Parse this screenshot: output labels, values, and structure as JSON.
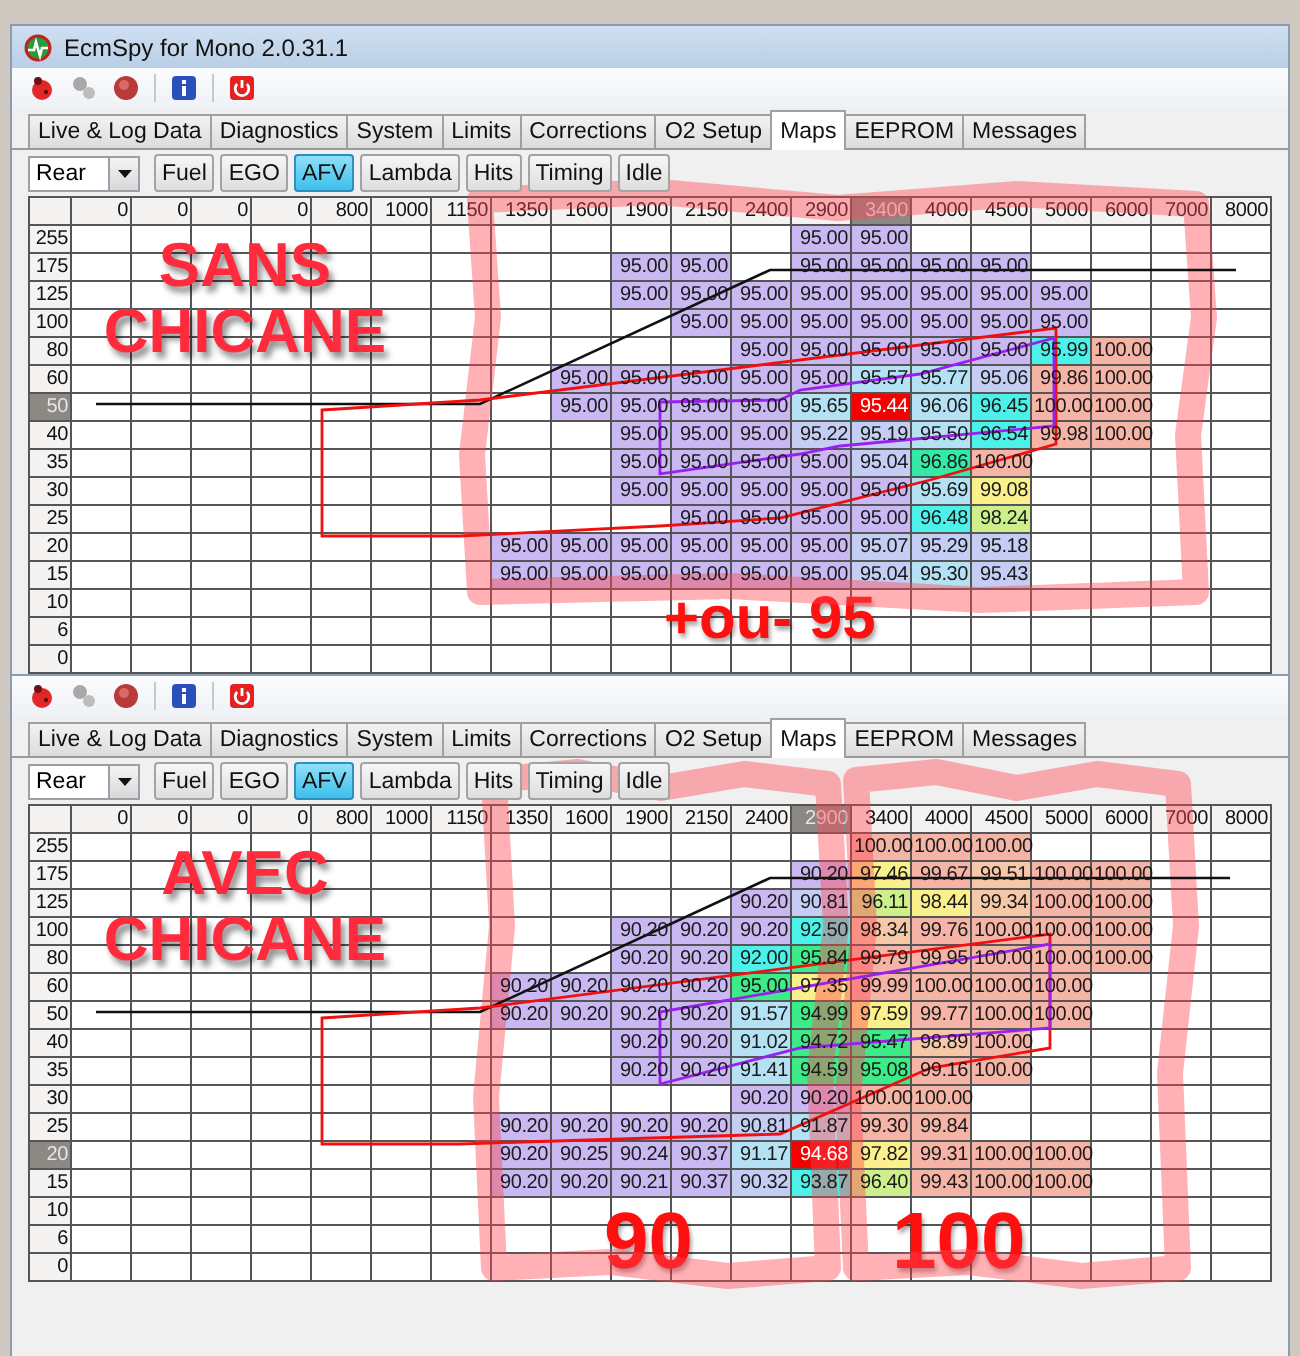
{
  "windows": [
    {
      "title": "EcmSpy for Mono 2.0.31.1",
      "tabs": [
        {
          "label": "Live & Log Data",
          "selected": false
        },
        {
          "label": "Diagnostics",
          "selected": false
        },
        {
          "label": "System",
          "selected": false
        },
        {
          "label": "Limits",
          "selected": false
        },
        {
          "label": "Corrections",
          "selected": false
        },
        {
          "label": "O2 Setup",
          "selected": false
        },
        {
          "label": "Maps",
          "selected": true
        },
        {
          "label": "EEPROM",
          "selected": false
        },
        {
          "label": "Messages",
          "selected": false
        }
      ],
      "map_selector": {
        "value": "Rear"
      },
      "map_buttons": [
        {
          "label": "Fuel",
          "selected": false
        },
        {
          "label": "EGO",
          "selected": false
        },
        {
          "label": "AFV",
          "selected": true
        },
        {
          "label": "Lambda",
          "selected": false
        },
        {
          "label": "Hits",
          "selected": false
        },
        {
          "label": "Timing",
          "selected": false
        },
        {
          "label": "Idle",
          "selected": false
        }
      ],
      "grid": {
        "columns": [
          {
            "label": "0",
            "selected": false
          },
          {
            "label": "0",
            "selected": false
          },
          {
            "label": "0",
            "selected": false
          },
          {
            "label": "0",
            "selected": false
          },
          {
            "label": "800",
            "selected": false
          },
          {
            "label": "1000",
            "selected": false
          },
          {
            "label": "1150",
            "selected": false
          },
          {
            "label": "1350",
            "selected": false
          },
          {
            "label": "1600",
            "selected": false
          },
          {
            "label": "1900",
            "selected": false
          },
          {
            "label": "2150",
            "selected": false
          },
          {
            "label": "2400",
            "selected": false
          },
          {
            "label": "2900",
            "selected": false
          },
          {
            "label": "3400",
            "selected": true
          },
          {
            "label": "4000",
            "selected": false
          },
          {
            "label": "4500",
            "selected": false
          },
          {
            "label": "5000",
            "selected": false
          },
          {
            "label": "6000",
            "selected": false
          },
          {
            "label": "7000",
            "selected": false
          },
          {
            "label": "8000",
            "selected": false
          }
        ],
        "rows": [
          {
            "label": "255",
            "selected": false,
            "cells": [
              null,
              null,
              null,
              null,
              null,
              null,
              null,
              null,
              null,
              null,
              null,
              null,
              {
                "value": "95.00",
                "color": "#c9b8f2"
              },
              {
                "value": "95.00",
                "color": "#c9b8f2"
              }
            ]
          },
          {
            "label": "175",
            "selected": false,
            "cells": [
              null,
              null,
              null,
              null,
              null,
              null,
              null,
              null,
              null,
              {
                "value": "95.00",
                "color": "#c9b8f2"
              },
              {
                "value": "95.00",
                "color": "#c9b8f2"
              },
              null,
              {
                "value": "95.00",
                "color": "#c9b8f2"
              },
              {
                "value": "95.00",
                "color": "#c9b8f2"
              },
              {
                "value": "95.00",
                "color": "#c9b8f2"
              },
              {
                "value": "95.00",
                "color": "#c9b8f2"
              }
            ]
          },
          {
            "label": "125",
            "selected": false,
            "cells": [
              null,
              null,
              null,
              null,
              null,
              null,
              null,
              null,
              null,
              {
                "value": "95.00",
                "color": "#c9b8f2"
              },
              {
                "value": "95.00",
                "color": "#c9b8f2"
              },
              {
                "value": "95.00",
                "color": "#c9b8f2"
              },
              {
                "value": "95.00",
                "color": "#c9b8f2"
              },
              {
                "value": "95.00",
                "color": "#c9b8f2"
              },
              {
                "value": "95.00",
                "color": "#c9b8f2"
              },
              {
                "value": "95.00",
                "color": "#c9b8f2"
              },
              {
                "value": "95.00",
                "color": "#c9b8f2"
              }
            ]
          },
          {
            "label": "100",
            "selected": false,
            "cells": [
              null,
              null,
              null,
              null,
              null,
              null,
              null,
              null,
              null,
              null,
              {
                "value": "95.00",
                "color": "#c9b8f2"
              },
              {
                "value": "95.00",
                "color": "#c9b8f2"
              },
              {
                "value": "95.00",
                "color": "#c9b8f2"
              },
              {
                "value": "95.00",
                "color": "#c9b8f2"
              },
              {
                "value": "95.00",
                "color": "#c9b8f2"
              },
              {
                "value": "95.00",
                "color": "#c9b8f2"
              },
              {
                "value": "95.00",
                "color": "#c9b8f2"
              }
            ]
          },
          {
            "label": "80",
            "selected": false,
            "cells": [
              null,
              null,
              null,
              null,
              null,
              null,
              null,
              null,
              null,
              null,
              null,
              {
                "value": "95.00",
                "color": "#c9b8f2"
              },
              {
                "value": "95.00",
                "color": "#c9b8f2"
              },
              {
                "value": "95.00",
                "color": "#c9b8f2"
              },
              {
                "value": "95.00",
                "color": "#c9b8f2"
              },
              {
                "value": "95.00",
                "color": "#c9b8f2"
              },
              {
                "value": "95.99",
                "color": "#4cf2ea"
              },
              {
                "value": "100.00",
                "color": "#f6b4a6"
              }
            ]
          },
          {
            "label": "60",
            "selected": false,
            "cells": [
              null,
              null,
              null,
              null,
              null,
              null,
              null,
              null,
              {
                "value": "95.00",
                "color": "#c9b8f2"
              },
              {
                "value": "95.00",
                "color": "#c9b8f2"
              },
              {
                "value": "95.00",
                "color": "#c9b8f2"
              },
              {
                "value": "95.00",
                "color": "#c9b8f2"
              },
              {
                "value": "95.00",
                "color": "#c9b8f2"
              },
              {
                "value": "95.57",
                "color": "#b4e2f4"
              },
              {
                "value": "95.77",
                "color": "#b4e2f4"
              },
              {
                "value": "95.06",
                "color": "#c4cef4"
              },
              {
                "value": "99.86",
                "color": "#f6b4a6"
              },
              {
                "value": "100.00",
                "color": "#f6b4a6"
              }
            ]
          },
          {
            "label": "50",
            "selected": true,
            "cells": [
              null,
              null,
              null,
              null,
              null,
              null,
              null,
              null,
              {
                "value": "95.00",
                "color": "#c9b8f2"
              },
              {
                "value": "95.00",
                "color": "#c9b8f2"
              },
              {
                "value": "95.00",
                "color": "#c9b8f2"
              },
              {
                "value": "95.00",
                "color": "#c9b8f2"
              },
              {
                "value": "95.65",
                "color": "#b4e2f4"
              },
              {
                "value": "95.44",
                "color": "#f40000"
              },
              {
                "value": "96.06",
                "color": "#b4e2f4"
              },
              {
                "value": "96.45",
                "color": "#4cf2ea"
              },
              {
                "value": "100.00",
                "color": "#f6b4a6"
              },
              {
                "value": "100.00",
                "color": "#f6b4a6"
              }
            ]
          },
          {
            "label": "40",
            "selected": false,
            "cells": [
              null,
              null,
              null,
              null,
              null,
              null,
              null,
              null,
              null,
              {
                "value": "95.00",
                "color": "#c9b8f2"
              },
              {
                "value": "95.00",
                "color": "#c9b8f2"
              },
              {
                "value": "95.00",
                "color": "#c9b8f2"
              },
              {
                "value": "95.22",
                "color": "#c4cef4"
              },
              {
                "value": "95.19",
                "color": "#c4cef4"
              },
              {
                "value": "95.50",
                "color": "#b4e2f4"
              },
              {
                "value": "96.54",
                "color": "#4cf2ea"
              },
              {
                "value": "99.98",
                "color": "#f6b4a6"
              },
              {
                "value": "100.00",
                "color": "#f6b4a6"
              }
            ]
          },
          {
            "label": "35",
            "selected": false,
            "cells": [
              null,
              null,
              null,
              null,
              null,
              null,
              null,
              null,
              null,
              {
                "value": "95.00",
                "color": "#c9b8f2"
              },
              {
                "value": "95.00",
                "color": "#c9b8f2"
              },
              {
                "value": "95.00",
                "color": "#c9b8f2"
              },
              {
                "value": "95.00",
                "color": "#c9b8f2"
              },
              {
                "value": "95.04",
                "color": "#c4cef4"
              },
              {
                "value": "96.86",
                "color": "#34eaa8"
              },
              {
                "value": "100.00",
                "color": "#f6b4a6"
              }
            ]
          },
          {
            "label": "30",
            "selected": false,
            "cells": [
              null,
              null,
              null,
              null,
              null,
              null,
              null,
              null,
              null,
              {
                "value": "95.00",
                "color": "#c9b8f2"
              },
              {
                "value": "95.00",
                "color": "#c9b8f2"
              },
              {
                "value": "95.00",
                "color": "#c9b8f2"
              },
              {
                "value": "95.00",
                "color": "#c9b8f2"
              },
              {
                "value": "95.00",
                "color": "#c9b8f2"
              },
              {
                "value": "95.69",
                "color": "#b4e2f4"
              },
              {
                "value": "99.08",
                "color": "#faf08c"
              }
            ]
          },
          {
            "label": "25",
            "selected": false,
            "cells": [
              null,
              null,
              null,
              null,
              null,
              null,
              null,
              null,
              null,
              null,
              {
                "value": "95.00",
                "color": "#c9b8f2"
              },
              {
                "value": "95.00",
                "color": "#c9b8f2"
              },
              {
                "value": "95.00",
                "color": "#c9b8f2"
              },
              {
                "value": "95.00",
                "color": "#c9b8f2"
              },
              {
                "value": "96.48",
                "color": "#4cf2ea"
              },
              {
                "value": "98.24",
                "color": "#cdf08c"
              }
            ]
          },
          {
            "label": "20",
            "selected": false,
            "cells": [
              null,
              null,
              null,
              null,
              null,
              null,
              null,
              {
                "value": "95.00",
                "color": "#c9b8f2"
              },
              {
                "value": "95.00",
                "color": "#c9b8f2"
              },
              {
                "value": "95.00",
                "color": "#c9b8f2"
              },
              {
                "value": "95.00",
                "color": "#c9b8f2"
              },
              {
                "value": "95.00",
                "color": "#c9b8f2"
              },
              {
                "value": "95.00",
                "color": "#c9b8f2"
              },
              {
                "value": "95.07",
                "color": "#c4cef4"
              },
              {
                "value": "95.29",
                "color": "#c4cef4"
              },
              {
                "value": "95.18",
                "color": "#c4cef4"
              }
            ]
          },
          {
            "label": "15",
            "selected": false,
            "cells": [
              null,
              null,
              null,
              null,
              null,
              null,
              null,
              {
                "value": "95.00",
                "color": "#c9b8f2"
              },
              {
                "value": "95.00",
                "color": "#c9b8f2"
              },
              {
                "value": "95.00",
                "color": "#c9b8f2"
              },
              {
                "value": "95.00",
                "color": "#c9b8f2"
              },
              {
                "value": "95.00",
                "color": "#c9b8f2"
              },
              {
                "value": "95.00",
                "color": "#c9b8f2"
              },
              {
                "value": "95.04",
                "color": "#c4cef4"
              },
              {
                "value": "95.30",
                "color": "#b4e2f4"
              },
              {
                "value": "95.43",
                "color": "#c4cef4"
              }
            ]
          },
          {
            "label": "10",
            "selected": false
          },
          {
            "label": "6",
            "selected": false
          },
          {
            "label": "0",
            "selected": false
          }
        ]
      },
      "annotations": [
        {
          "kind": "title",
          "text": "SANS CHICANE"
        },
        {
          "kind": "note",
          "text": "+ou- 95"
        }
      ]
    },
    {
      "tabs": [
        {
          "label": "Live & Log Data",
          "selected": false
        },
        {
          "label": "Diagnostics",
          "selected": false
        },
        {
          "label": "System",
          "selected": false
        },
        {
          "label": "Limits",
          "selected": false
        },
        {
          "label": "Corrections",
          "selected": false
        },
        {
          "label": "O2 Setup",
          "selected": false
        },
        {
          "label": "Maps",
          "selected": true
        },
        {
          "label": "EEPROM",
          "selected": false
        },
        {
          "label": "Messages",
          "selected": false
        }
      ],
      "map_selector": {
        "value": "Rear"
      },
      "map_buttons": [
        {
          "label": "Fuel",
          "selected": false
        },
        {
          "label": "EGO",
          "selected": false
        },
        {
          "label": "AFV",
          "selected": true
        },
        {
          "label": "Lambda",
          "selected": false
        },
        {
          "label": "Hits",
          "selected": false
        },
        {
          "label": "Timing",
          "selected": false
        },
        {
          "label": "Idle",
          "selected": false
        }
      ],
      "grid": {
        "columns": [
          {
            "label": "0",
            "selected": false
          },
          {
            "label": "0",
            "selected": false
          },
          {
            "label": "0",
            "selected": false
          },
          {
            "label": "0",
            "selected": false
          },
          {
            "label": "800",
            "selected": false
          },
          {
            "label": "1000",
            "selected": false
          },
          {
            "label": "1150",
            "selected": false
          },
          {
            "label": "1350",
            "selected": false
          },
          {
            "label": "1600",
            "selected": false
          },
          {
            "label": "1900",
            "selected": false
          },
          {
            "label": "2150",
            "selected": false
          },
          {
            "label": "2400",
            "selected": false
          },
          {
            "label": "2900",
            "selected": true
          },
          {
            "label": "3400",
            "selected": false
          },
          {
            "label": "4000",
            "selected": false
          },
          {
            "label": "4500",
            "selected": false
          },
          {
            "label": "5000",
            "selected": false
          },
          {
            "label": "6000",
            "selected": false
          },
          {
            "label": "7000",
            "selected": false
          },
          {
            "label": "8000",
            "selected": false
          }
        ],
        "rows": [
          {
            "label": "255",
            "selected": false,
            "cells": [
              null,
              null,
              null,
              null,
              null,
              null,
              null,
              null,
              null,
              null,
              null,
              null,
              null,
              {
                "value": "100.00",
                "color": "#f6b4a6"
              },
              {
                "value": "100.00",
                "color": "#f6b4a6"
              },
              {
                "value": "100.00",
                "color": "#f6b4a6"
              }
            ]
          },
          {
            "label": "175",
            "selected": false,
            "cells": [
              null,
              null,
              null,
              null,
              null,
              null,
              null,
              null,
              null,
              null,
              null,
              null,
              {
                "value": "90.20",
                "color": "#c9b8f2"
              },
              {
                "value": "97.46",
                "color": "#faf08c"
              },
              {
                "value": "99.67",
                "color": "#f6b4a6"
              },
              {
                "value": "99.51",
                "color": "#f6c8a8"
              },
              {
                "value": "100.00",
                "color": "#f6b4a6"
              },
              {
                "value": "100.00",
                "color": "#f6b4a6"
              }
            ]
          },
          {
            "label": "125",
            "selected": false,
            "cells": [
              null,
              null,
              null,
              null,
              null,
              null,
              null,
              null,
              null,
              null,
              null,
              {
                "value": "90.20",
                "color": "#c9b8f2"
              },
              {
                "value": "90.81",
                "color": "#c4cef4"
              },
              {
                "value": "96.11",
                "color": "#cdf08c"
              },
              {
                "value": "98.44",
                "color": "#faf08c"
              },
              {
                "value": "99.34",
                "color": "#f6c8a8"
              },
              {
                "value": "100.00",
                "color": "#f6b4a6"
              },
              {
                "value": "100.00",
                "color": "#f6b4a6"
              }
            ]
          },
          {
            "label": "100",
            "selected": false,
            "cells": [
              null,
              null,
              null,
              null,
              null,
              null,
              null,
              null,
              null,
              {
                "value": "90.20",
                "color": "#c9b8f2"
              },
              {
                "value": "90.20",
                "color": "#c9b8f2"
              },
              {
                "value": "90.20",
                "color": "#c9b8f2"
              },
              {
                "value": "92.50",
                "color": "#4cf2ea"
              },
              {
                "value": "98.34",
                "color": "#f6c8a8"
              },
              {
                "value": "99.76",
                "color": "#f6b4a6"
              },
              {
                "value": "100.00",
                "color": "#f6b4a6"
              },
              {
                "value": "100.00",
                "color": "#f6b4a6"
              },
              {
                "value": "100.00",
                "color": "#f6b4a6"
              }
            ]
          },
          {
            "label": "80",
            "selected": false,
            "cells": [
              null,
              null,
              null,
              null,
              null,
              null,
              null,
              null,
              null,
              {
                "value": "90.20",
                "color": "#c9b8f2"
              },
              {
                "value": "90.20",
                "color": "#c9b8f2"
              },
              {
                "value": "92.00",
                "color": "#4cf2ea"
              },
              {
                "value": "95.84",
                "color": "#3cec88"
              },
              {
                "value": "99.79",
                "color": "#f6b4a6"
              },
              {
                "value": "99.95",
                "color": "#f6b4a6"
              },
              {
                "value": "100.00",
                "color": "#f6b4a6"
              },
              {
                "value": "100.00",
                "color": "#f6b4a6"
              },
              {
                "value": "100.00",
                "color": "#f6b4a6"
              }
            ]
          },
          {
            "label": "60",
            "selected": false,
            "cells": [
              null,
              null,
              null,
              null,
              null,
              null,
              null,
              {
                "value": "90.20",
                "color": "#c9b8f2"
              },
              {
                "value": "90.20",
                "color": "#c9b8f2"
              },
              {
                "value": "90.20",
                "color": "#c9b8f2"
              },
              {
                "value": "90.20",
                "color": "#c9b8f2"
              },
              {
                "value": "95.00",
                "color": "#3cec88"
              },
              {
                "value": "97.35",
                "color": "#faf08c"
              },
              {
                "value": "99.99",
                "color": "#f6b4a6"
              },
              {
                "value": "100.00",
                "color": "#f6b4a6"
              },
              {
                "value": "100.00",
                "color": "#f6b4a6"
              },
              {
                "value": "100.00",
                "color": "#f6b4a6"
              }
            ]
          },
          {
            "label": "50",
            "selected": false,
            "cells": [
              null,
              null,
              null,
              null,
              null,
              null,
              null,
              {
                "value": "90.20",
                "color": "#c9b8f2"
              },
              {
                "value": "90.20",
                "color": "#c9b8f2"
              },
              {
                "value": "90.20",
                "color": "#c9b8f2"
              },
              {
                "value": "90.20",
                "color": "#c9b8f2"
              },
              {
                "value": "91.57",
                "color": "#b4e2f4"
              },
              {
                "value": "94.99",
                "color": "#3cec88"
              },
              {
                "value": "97.59",
                "color": "#faf08c"
              },
              {
                "value": "99.77",
                "color": "#f6b4a6"
              },
              {
                "value": "100.00",
                "color": "#f6b4a6"
              },
              {
                "value": "100.00",
                "color": "#f6b4a6"
              }
            ]
          },
          {
            "label": "40",
            "selected": false,
            "cells": [
              null,
              null,
              null,
              null,
              null,
              null,
              null,
              null,
              null,
              {
                "value": "90.20",
                "color": "#c9b8f2"
              },
              {
                "value": "90.20",
                "color": "#c9b8f2"
              },
              {
                "value": "91.02",
                "color": "#b4e2f4"
              },
              {
                "value": "94.72",
                "color": "#3cec88"
              },
              {
                "value": "95.47",
                "color": "#3cec88"
              },
              {
                "value": "98.89",
                "color": "#f6c8a8"
              },
              {
                "value": "100.00",
                "color": "#f6b4a6"
              }
            ]
          },
          {
            "label": "35",
            "selected": false,
            "cells": [
              null,
              null,
              null,
              null,
              null,
              null,
              null,
              null,
              null,
              {
                "value": "90.20",
                "color": "#c9b8f2"
              },
              {
                "value": "90.20",
                "color": "#c9b8f2"
              },
              {
                "value": "91.41",
                "color": "#b4e2f4"
              },
              {
                "value": "94.59",
                "color": "#3cec88"
              },
              {
                "value": "95.08",
                "color": "#3cec88"
              },
              {
                "value": "99.16",
                "color": "#f6b4a6"
              },
              {
                "value": "100.00",
                "color": "#f6b4a6"
              }
            ]
          },
          {
            "label": "30",
            "selected": false,
            "cells": [
              null,
              null,
              null,
              null,
              null,
              null,
              null,
              null,
              null,
              null,
              null,
              {
                "value": "90.20",
                "color": "#c9b8f2"
              },
              {
                "value": "90.20",
                "color": "#c9b8f2"
              },
              {
                "value": "100.00",
                "color": "#f6b4a6"
              },
              {
                "value": "100.00",
                "color": "#f6b4a6"
              }
            ]
          },
          {
            "label": "25",
            "selected": false,
            "cells": [
              null,
              null,
              null,
              null,
              null,
              null,
              null,
              {
                "value": "90.20",
                "color": "#c9b8f2"
              },
              {
                "value": "90.20",
                "color": "#c9b8f2"
              },
              {
                "value": "90.20",
                "color": "#c9b8f2"
              },
              {
                "value": "90.20",
                "color": "#c9b8f2"
              },
              {
                "value": "90.81",
                "color": "#c4cef4"
              },
              {
                "value": "91.87",
                "color": "#b4e2f4"
              },
              {
                "value": "99.30",
                "color": "#f6b4a6"
              },
              {
                "value": "99.84",
                "color": "#f6b4a6"
              }
            ]
          },
          {
            "label": "20",
            "selected": true,
            "cells": [
              null,
              null,
              null,
              null,
              null,
              null,
              null,
              {
                "value": "90.20",
                "color": "#c9b8f2"
              },
              {
                "value": "90.25",
                "color": "#c9b8f2"
              },
              {
                "value": "90.24",
                "color": "#c9b8f2"
              },
              {
                "value": "90.37",
                "color": "#c9b8f2"
              },
              {
                "value": "91.17",
                "color": "#b4e2f4"
              },
              {
                "value": "94.68",
                "color": "#f40000"
              },
              {
                "value": "97.82",
                "color": "#faf08c"
              },
              {
                "value": "99.31",
                "color": "#f6b4a6"
              },
              {
                "value": "100.00",
                "color": "#f6b4a6"
              },
              {
                "value": "100.00",
                "color": "#f6b4a6"
              }
            ]
          },
          {
            "label": "15",
            "selected": false,
            "cells": [
              null,
              null,
              null,
              null,
              null,
              null,
              null,
              {
                "value": "90.20",
                "color": "#c9b8f2"
              },
              {
                "value": "90.20",
                "color": "#c9b8f2"
              },
              {
                "value": "90.21",
                "color": "#c9b8f2"
              },
              {
                "value": "90.37",
                "color": "#c9b8f2"
              },
              {
                "value": "90.32",
                "color": "#c4cef4"
              },
              {
                "value": "93.87",
                "color": "#4cf2ea"
              },
              {
                "value": "96.40",
                "color": "#cdf08c"
              },
              {
                "value": "99.43",
                "color": "#f6b4a6"
              },
              {
                "value": "100.00",
                "color": "#f6b4a6"
              },
              {
                "value": "100.00",
                "color": "#f6b4a6"
              }
            ]
          },
          {
            "label": "10",
            "selected": false
          },
          {
            "label": "6",
            "selected": false
          },
          {
            "label": "0",
            "selected": false
          }
        ]
      },
      "annotations": [
        {
          "kind": "title",
          "text": "AVEC CHICANE"
        },
        {
          "kind": "note",
          "text": "90"
        },
        {
          "kind": "note",
          "text": "100"
        }
      ]
    }
  ]
}
